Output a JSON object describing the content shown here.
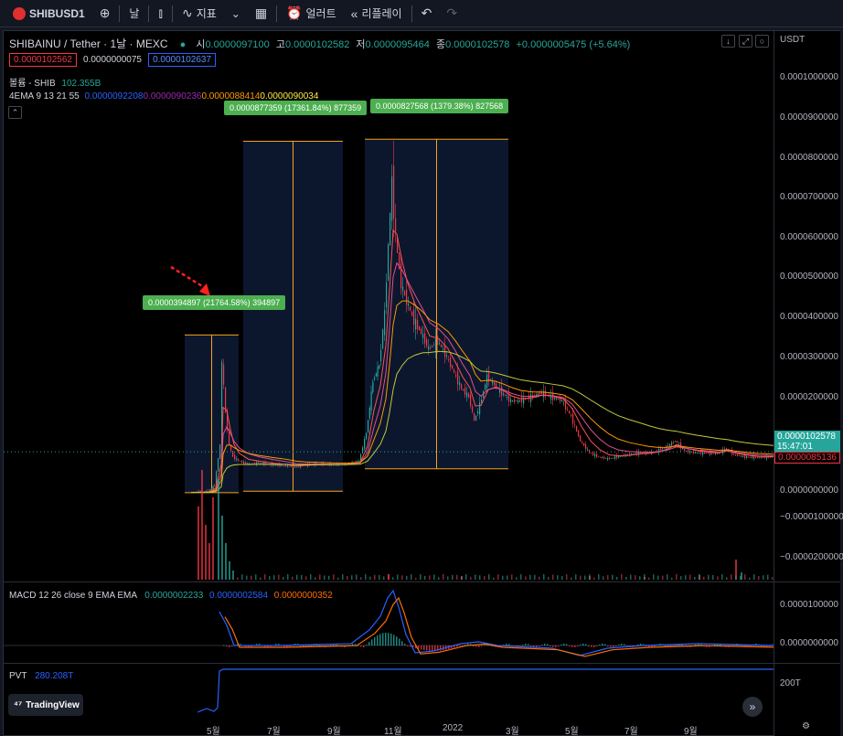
{
  "toolbar": {
    "symbol": "SHIBUSD1",
    "interval": "날",
    "indicators_label": "지표",
    "alert_label": "얼러트",
    "replay_label": "리플레이"
  },
  "header": {
    "title": "SHIBAINU / Tether · 1날 · MEXC",
    "open_label": "시",
    "open": "0.0000097100",
    "high_label": "고",
    "high": "0.0000102582",
    "low_label": "저",
    "low": "0.0000095464",
    "close_label": "종",
    "close": "0.0000102578",
    "change": "+0.0000005475 (+5.64%)",
    "bid": "0.0000102562",
    "spread": "0.0000000075",
    "ask": "0.0000102637"
  },
  "volume_legend": {
    "label": "볼륨 - SHIB",
    "value": "102.355B"
  },
  "ema_legend": {
    "label": "4EMA 9 13 21 55",
    "v1": "0.0000092208",
    "v2": "0.0000090236",
    "v3": "0.0000088414",
    "v4": "0.0000090034"
  },
  "measures": [
    {
      "text": "0.0000394897 (21764.58%) 394897"
    },
    {
      "text": "0.0000877359 (17361.84%) 877359"
    },
    {
      "text": "0.0000827568 (1379.38%) 827568"
    }
  ],
  "price_axis": {
    "currency": "USDT",
    "labels": [
      "0.0001000000",
      "0.0000900000",
      "0.0000800000",
      "0.0000700000",
      "0.0000600000",
      "0.0000500000",
      "0.0000400000",
      "0.0000300000",
      "0.0000200000",
      "0.0000000000",
      "−0.0000100000",
      "−0.0000200000"
    ],
    "last_price": "0.0000102578",
    "countdown": "15:47:01",
    "prev_price": "0.0000085136"
  },
  "macd": {
    "label": "MACD 12 26 close 9 EMA EMA",
    "v1": "0.0000002233",
    "v2": "0.0000002584",
    "v3": "0.0000000352",
    "axis": [
      "0.0000100000",
      "0.0000000000"
    ]
  },
  "pvt": {
    "label": "PVT",
    "value": "280.208T",
    "axis": "200T"
  },
  "time_axis": [
    "5월",
    "7월",
    "9월",
    "11월",
    "2022",
    "3월",
    "5월",
    "7월",
    "9월"
  ],
  "branding": "TradingView",
  "colors": {
    "up": "#26a69a",
    "down": "#f23645",
    "measure_bg": "#4caf50",
    "range_bg": "#0d1a33",
    "range_line": "#f7a21b",
    "macd_line": "#2962ff",
    "signal_line": "#ff6d00",
    "ema_yellow": "#c3c83a"
  }
}
